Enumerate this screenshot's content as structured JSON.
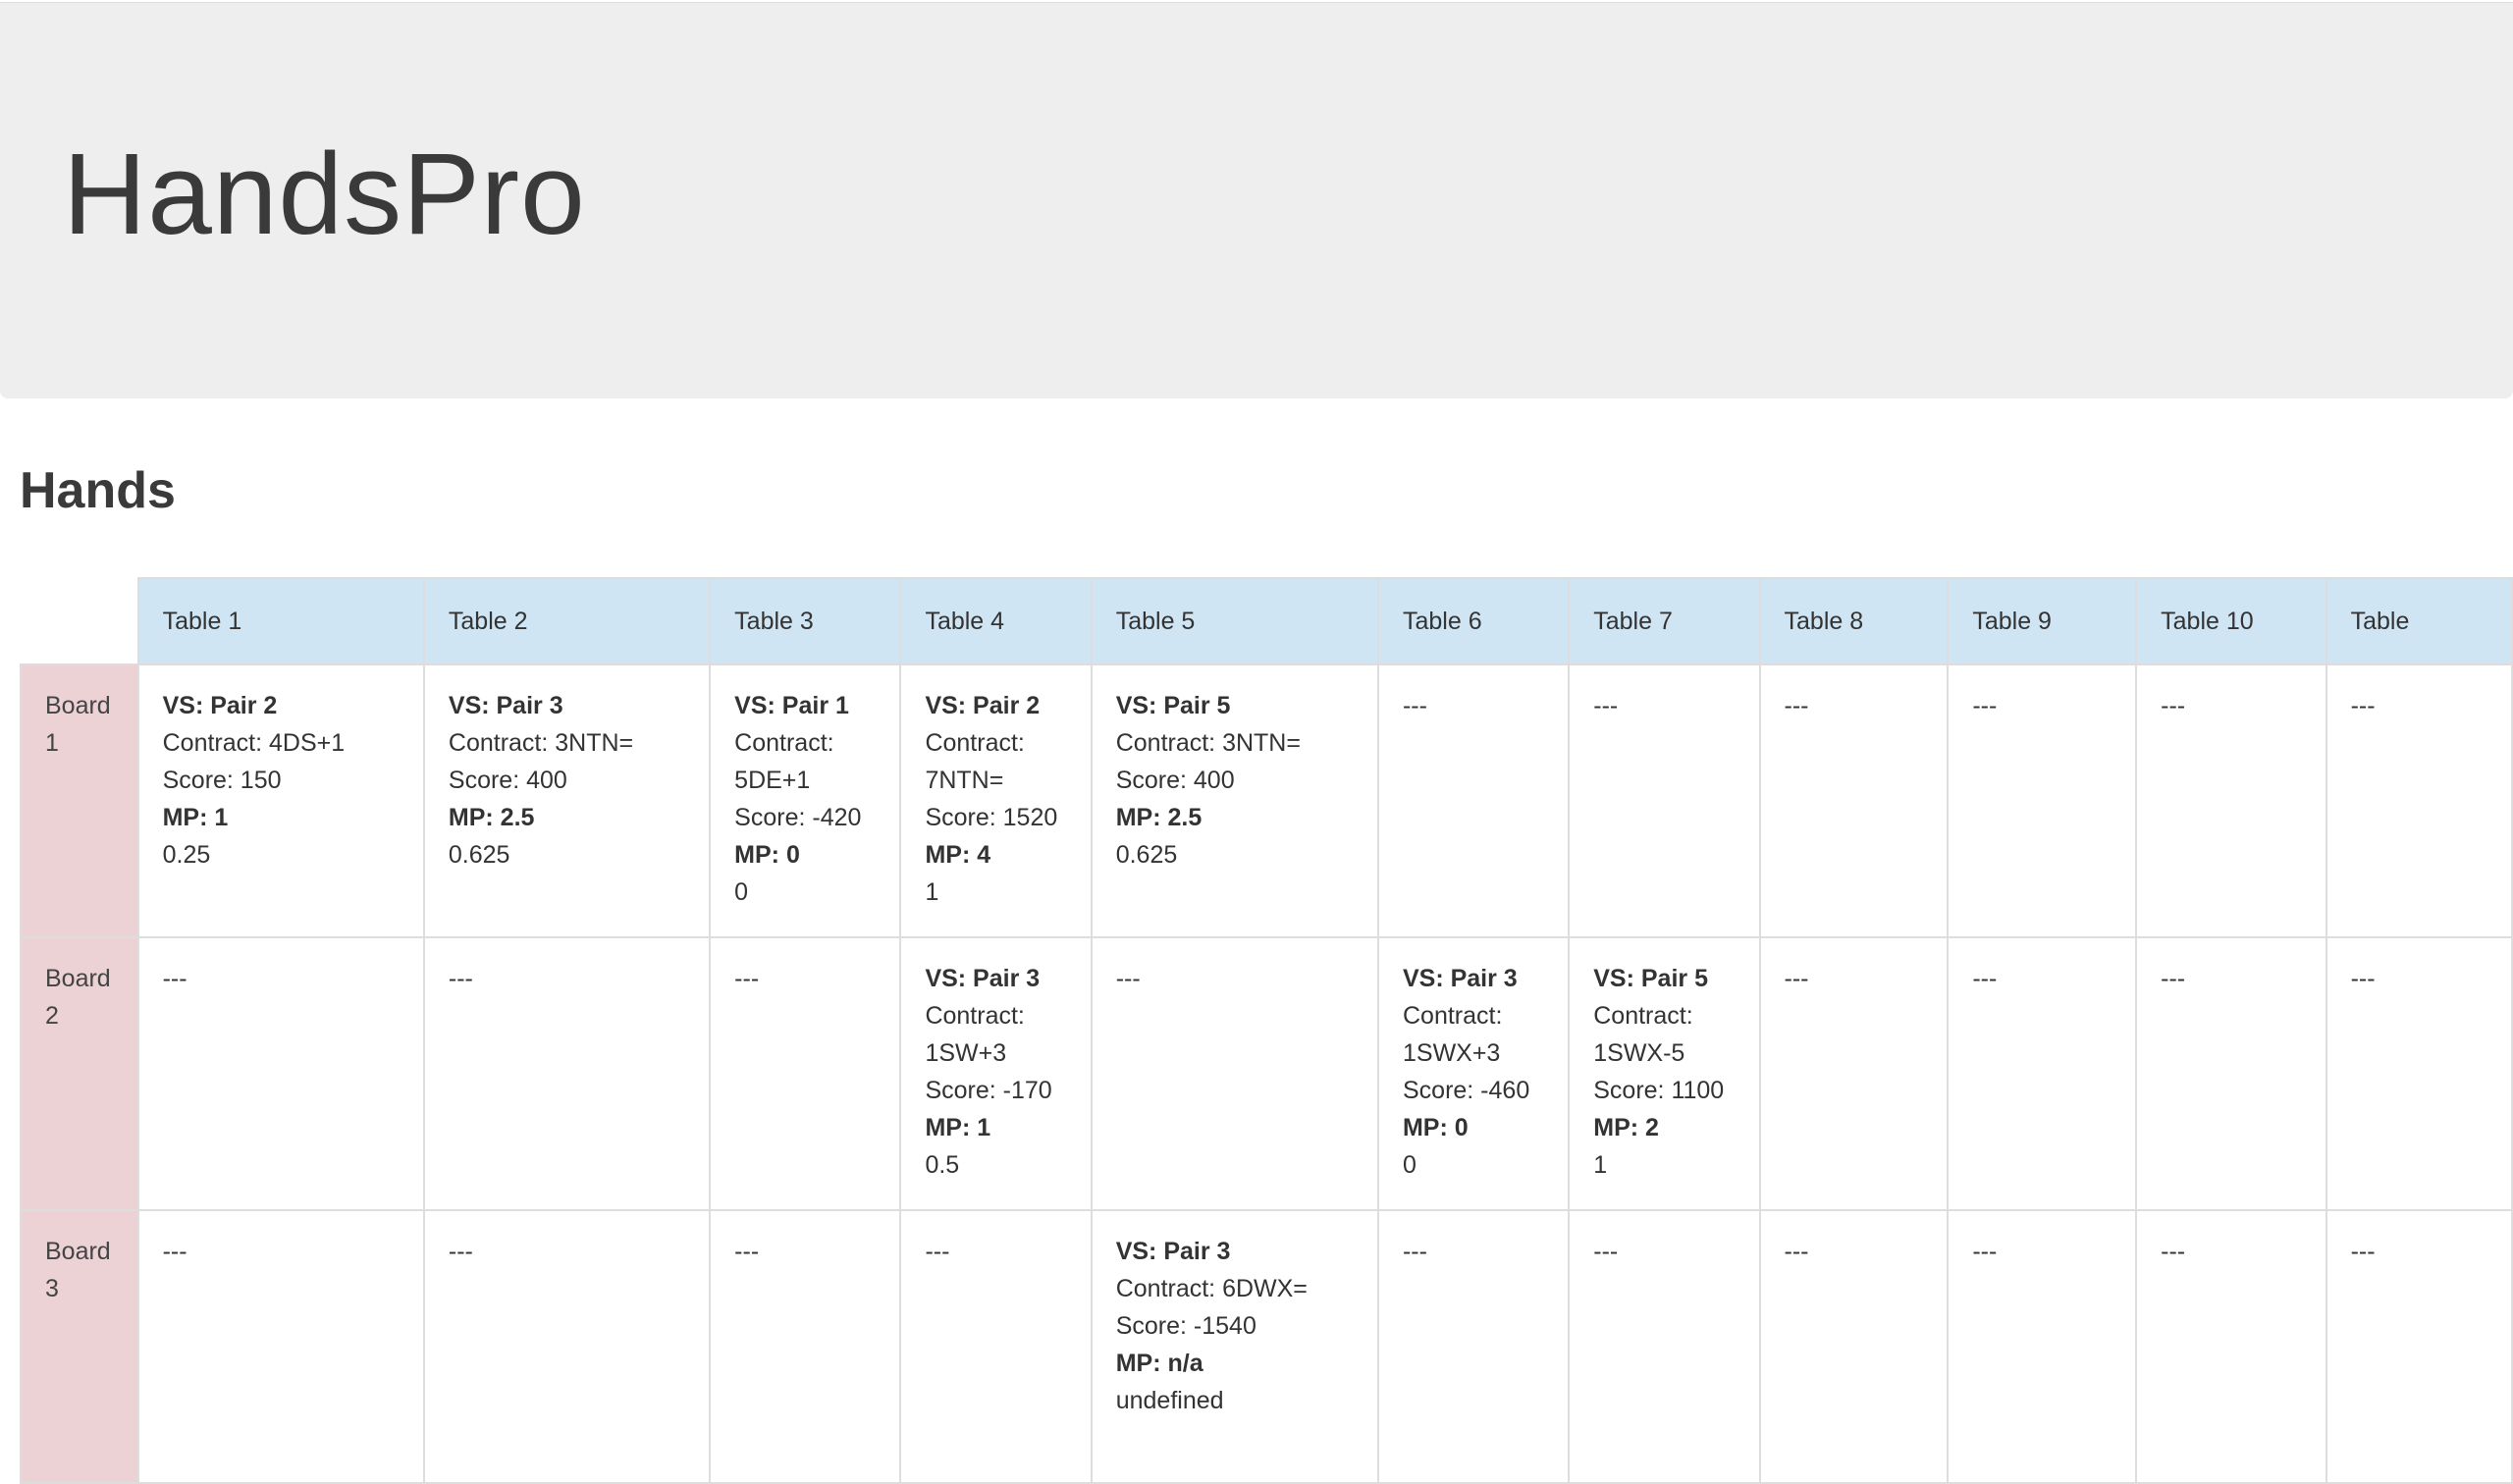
{
  "header": {
    "title": "HandsPro"
  },
  "section": {
    "title": "Hands"
  },
  "table": {
    "columns": [
      "Table 1",
      "Table 2",
      "Table 3",
      "Table 4",
      "Table 5",
      "Table 6",
      "Table 7",
      "Table 8",
      "Table 9",
      "Table 10",
      "Table"
    ],
    "rows": [
      {
        "label": "Board 1",
        "cells": [
          {
            "vs": "VS: Pair 2",
            "contract": "Contract: 4DS+1",
            "score": "Score: 150",
            "mp": "MP: 1",
            "ratio": "0.25"
          },
          {
            "vs": "VS: Pair 3",
            "contract": "Contract: 3NTN=",
            "score": "Score: 400",
            "mp": "MP: 2.5",
            "ratio": "0.625"
          },
          {
            "vs": "VS: Pair 1",
            "contract": "Contract: 5DE+1",
            "score": "Score: -420",
            "mp": "MP: 0",
            "ratio": "0"
          },
          {
            "vs": "VS: Pair 2",
            "contract": "Contract: 7NTN=",
            "score": "Score: 1520",
            "mp": "MP: 4",
            "ratio": "1"
          },
          {
            "vs": "VS: Pair 5",
            "contract": "Contract: 3NTN=",
            "score": "Score: 400",
            "mp": "MP: 2.5",
            "ratio": "0.625"
          },
          {
            "empty": "---"
          },
          {
            "empty": "---"
          },
          {
            "empty": "---"
          },
          {
            "empty": "---"
          },
          {
            "empty": "---"
          },
          {
            "empty": "---"
          }
        ]
      },
      {
        "label": "Board 2",
        "cells": [
          {
            "empty": "---"
          },
          {
            "empty": "---"
          },
          {
            "empty": "---"
          },
          {
            "vs": "VS: Pair 3",
            "contract": "Contract: 1SW+3",
            "score": "Score: -170",
            "mp": "MP: 1",
            "ratio": "0.5"
          },
          {
            "empty": "---"
          },
          {
            "vs": "VS: Pair 3",
            "contract": "Contract: 1SWX+3",
            "score": "Score: -460",
            "mp": "MP: 0",
            "ratio": "0"
          },
          {
            "vs": "VS: Pair 5",
            "contract": "Contract: 1SWX-5",
            "score": "Score: 1100",
            "mp": "MP: 2",
            "ratio": "1"
          },
          {
            "empty": "---"
          },
          {
            "empty": "---"
          },
          {
            "empty": "---"
          },
          {
            "empty": "---"
          }
        ]
      },
      {
        "label": "Board 3",
        "cells": [
          {
            "empty": "---"
          },
          {
            "empty": "---"
          },
          {
            "empty": "---"
          },
          {
            "empty": "---"
          },
          {
            "vs": "VS: Pair 3",
            "contract": "Contract: 6DWX=",
            "score": "Score: -1540",
            "mp": "MP: n/a",
            "ratio": "undefined"
          },
          {
            "empty": "---"
          },
          {
            "empty": "---"
          },
          {
            "empty": "---"
          },
          {
            "empty": "---"
          },
          {
            "empty": "---"
          },
          {
            "empty": "---"
          }
        ]
      }
    ]
  },
  "colors": {
    "header_bg": "#cfe5f4",
    "board_bg": "#ecd1d5",
    "jumbotron_bg": "#eeeeee"
  }
}
